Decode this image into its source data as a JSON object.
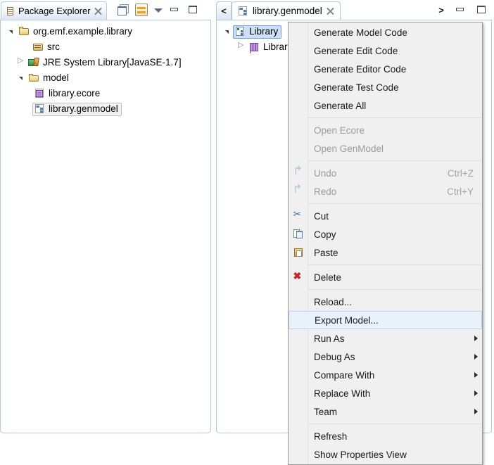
{
  "package_explorer": {
    "tab_label": "Package Explorer",
    "tab_icon": "package-explorer-icon",
    "close_icon": "close-icon",
    "toolbar": [
      {
        "name": "collapse-all-button",
        "icon": "collapse-all-icon"
      },
      {
        "name": "link-with-editor-button",
        "icon": "link-with-editor-icon"
      },
      {
        "name": "view-menu-button",
        "icon": "chevron-down-icon"
      },
      {
        "name": "minimize-button",
        "icon": "minimize-icon"
      },
      {
        "name": "maximize-button",
        "icon": "maximize-icon"
      }
    ],
    "tree": [
      {
        "label": "org.emf.example.library",
        "suffix": "",
        "indent": 0,
        "twisty": "open",
        "icon": "java-project-icon",
        "selected": false
      },
      {
        "label": "src",
        "suffix": "",
        "indent": 1,
        "twisty": "none",
        "icon": "source-folder-icon",
        "selected": false
      },
      {
        "label": "JRE System Library ",
        "suffix": "[JavaSE-1.7]",
        "indent": 1,
        "twisty": "closed",
        "icon": "jre-library-icon",
        "selected": false
      },
      {
        "label": "model",
        "suffix": "",
        "indent": 1,
        "twisty": "open",
        "icon": "folder-icon",
        "selected": false
      },
      {
        "label": "library.ecore",
        "suffix": "",
        "indent": 2,
        "twisty": "none",
        "icon": "ecore-file-icon",
        "selected": false
      },
      {
        "label": "library.genmodel",
        "suffix": "",
        "indent": 2,
        "twisty": "none",
        "icon": "genmodel-file-icon",
        "selected": true
      }
    ]
  },
  "editor": {
    "prev_chevron": "<",
    "next_chevron": ">",
    "tab_label": "library.genmodel",
    "tab_icon": "genmodel-file-icon",
    "close_icon": "close-icon",
    "toolbar": [
      {
        "name": "minimize-button",
        "icon": "minimize-icon"
      },
      {
        "name": "maximize-button",
        "icon": "maximize-icon"
      }
    ],
    "tree": [
      {
        "label": "Library",
        "indent": 0,
        "twisty": "open",
        "icon": "genmodel-root-icon",
        "selected": true
      },
      {
        "label": "Library",
        "indent": 1,
        "twisty": "closed",
        "icon": "epackage-icon",
        "selected": false
      }
    ]
  },
  "context_menu": {
    "items": [
      {
        "label": "Generate Model Code",
        "accel": "",
        "icon": "",
        "disabled": false,
        "submenu": false,
        "highlight": false
      },
      {
        "label": "Generate Edit Code",
        "accel": "",
        "icon": "",
        "disabled": false,
        "submenu": false,
        "highlight": false
      },
      {
        "label": "Generate Editor Code",
        "accel": "",
        "icon": "",
        "disabled": false,
        "submenu": false,
        "highlight": false
      },
      {
        "label": "Generate Test Code",
        "accel": "",
        "icon": "",
        "disabled": false,
        "submenu": false,
        "highlight": false
      },
      {
        "label": "Generate All",
        "accel": "",
        "icon": "",
        "disabled": false,
        "submenu": false,
        "highlight": false
      },
      {
        "separator": true
      },
      {
        "label": "Open Ecore",
        "accel": "",
        "icon": "",
        "disabled": true,
        "submenu": false,
        "highlight": false
      },
      {
        "label": "Open GenModel",
        "accel": "",
        "icon": "",
        "disabled": true,
        "submenu": false,
        "highlight": false
      },
      {
        "separator": true
      },
      {
        "label": "Undo",
        "accel": "Ctrl+Z",
        "icon": "undo-icon",
        "disabled": true,
        "submenu": false,
        "highlight": false
      },
      {
        "label": "Redo",
        "accel": "Ctrl+Y",
        "icon": "redo-icon",
        "disabled": true,
        "submenu": false,
        "highlight": false
      },
      {
        "separator": true
      },
      {
        "label": "Cut",
        "accel": "",
        "icon": "cut-icon",
        "disabled": false,
        "submenu": false,
        "highlight": false
      },
      {
        "label": "Copy",
        "accel": "",
        "icon": "copy-icon",
        "disabled": false,
        "submenu": false,
        "highlight": false
      },
      {
        "label": "Paste",
        "accel": "",
        "icon": "paste-icon",
        "disabled": false,
        "submenu": false,
        "highlight": false
      },
      {
        "separator": true
      },
      {
        "label": "Delete",
        "accel": "",
        "icon": "delete-icon",
        "disabled": false,
        "submenu": false,
        "highlight": false
      },
      {
        "separator": true
      },
      {
        "label": "Reload...",
        "accel": "",
        "icon": "",
        "disabled": false,
        "submenu": false,
        "highlight": false
      },
      {
        "label": "Export Model...",
        "accel": "",
        "icon": "",
        "disabled": false,
        "submenu": false,
        "highlight": true
      },
      {
        "label": "Run As",
        "accel": "",
        "icon": "",
        "disabled": false,
        "submenu": true,
        "highlight": false
      },
      {
        "label": "Debug As",
        "accel": "",
        "icon": "",
        "disabled": false,
        "submenu": true,
        "highlight": false
      },
      {
        "label": "Compare With",
        "accel": "",
        "icon": "",
        "disabled": false,
        "submenu": true,
        "highlight": false
      },
      {
        "label": "Replace With",
        "accel": "",
        "icon": "",
        "disabled": false,
        "submenu": true,
        "highlight": false
      },
      {
        "label": "Team",
        "accel": "",
        "icon": "",
        "disabled": false,
        "submenu": true,
        "highlight": false
      },
      {
        "separator": true
      },
      {
        "label": "Refresh",
        "accel": "",
        "icon": "",
        "disabled": false,
        "submenu": false,
        "highlight": false
      },
      {
        "label": "Show Properties View",
        "accel": "",
        "icon": "",
        "disabled": false,
        "submenu": false,
        "highlight": false
      }
    ]
  },
  "colors": {
    "tab_border": "#b6c7de",
    "menu_bg": "#f0f0f0",
    "menu_border": "#9b9b9b",
    "highlight_bg": "#e9f1fb",
    "highlight_border": "#b6d2ef",
    "selection_bg": "#cde0f5",
    "disabled_text": "#9a9a9a",
    "dim_text": "#9c8a6a"
  }
}
